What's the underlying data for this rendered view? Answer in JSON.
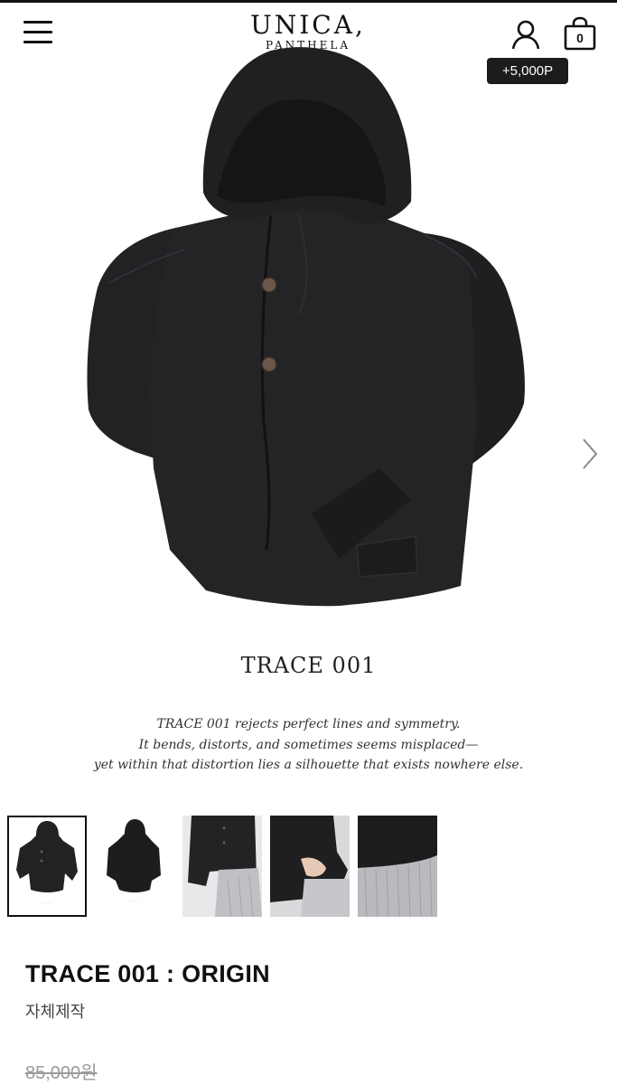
{
  "header": {
    "brand": "UNICA,",
    "brand_sub": "PANTHELA",
    "cart_count": "0",
    "points_badge": "+5,000P"
  },
  "hero": {
    "image": "black-hooded-jacket",
    "arrow_icon": "chevron-right-icon"
  },
  "product_story": {
    "title": "TRACE 001",
    "lines": [
      "TRACE 001 rejects perfect lines and symmetry.",
      "It bends, distorts, and sometimes seems misplaced—",
      "yet within that distortion lies a silhouette that exists nowhere else."
    ]
  },
  "gallery": {
    "thumbnails": [
      {
        "label": "front view with text",
        "active": true
      },
      {
        "label": "back view with text",
        "active": false
      },
      {
        "label": "worn detail front",
        "active": false
      },
      {
        "label": "worn pocket detail",
        "active": false
      },
      {
        "label": "sleeve hem detail",
        "active": false
      }
    ]
  },
  "product": {
    "name": "TRACE 001 : ORIGIN",
    "maker": "자체제작",
    "original_price": "85,000원"
  },
  "colors": {
    "jacket": "#232325",
    "badge_bg": "#1c1c1c",
    "strike_price": "#9a9a9a"
  }
}
